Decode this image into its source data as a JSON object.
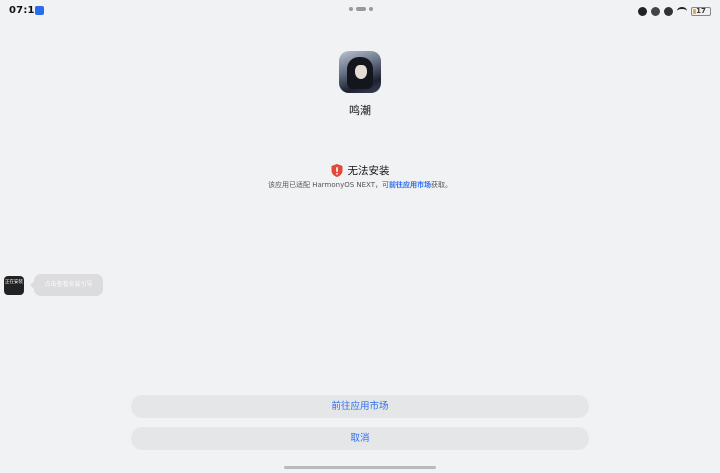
{
  "status_bar": {
    "time": "07:13",
    "battery_text": "17",
    "battery_level_percent": 17,
    "battery_color": "#f0a844"
  },
  "app": {
    "name": "鸣潮"
  },
  "error": {
    "title": "无法安装",
    "desc_prefix": "该应用已适配 HarmonyOS NEXT，可",
    "desc_link": "前往应用市场",
    "desc_suffix": "获取。",
    "icon": "shield-alert-icon",
    "icon_color": "#e04a3a"
  },
  "floating": {
    "bubble_text": "正在安装",
    "tooltip_text": "点击查看安装引导"
  },
  "buttons": {
    "primary_label": "前往应用市场",
    "cancel_label": "取消"
  },
  "colors": {
    "accent": "#2a6cf0",
    "background": "#f1f2f4",
    "button_bg": "#e5e6e8"
  }
}
